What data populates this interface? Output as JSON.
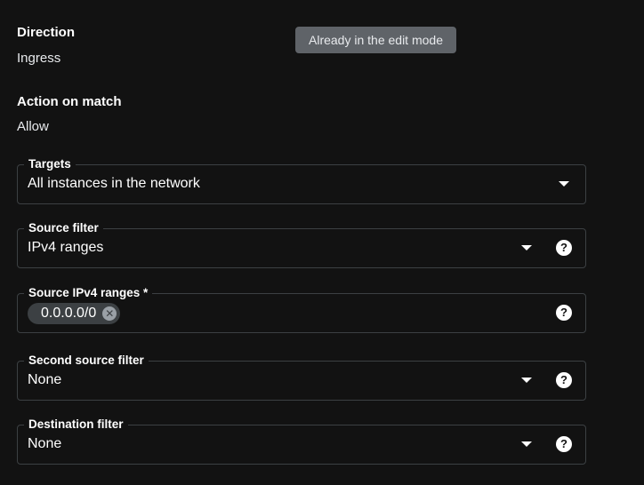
{
  "direction": {
    "label": "Direction",
    "value": "Ingress"
  },
  "action": {
    "label": "Action on match",
    "value": "Allow"
  },
  "tooltip": {
    "text": "Already in the edit mode"
  },
  "targets": {
    "label": "Targets",
    "value": "All instances in the network",
    "arrow_icon": "dropdown-arrow-icon"
  },
  "source_filter": {
    "label": "Source filter",
    "value": "IPv4 ranges",
    "arrow_icon": "dropdown-arrow-icon",
    "help_icon": "?"
  },
  "source_ipv4": {
    "label": "Source IPv4 ranges *",
    "chips": [
      "0.0.0.0/0"
    ],
    "chip_remove_icon": "✕",
    "help_icon": "?"
  },
  "second_source_filter": {
    "label": "Second source filter",
    "value": "None",
    "arrow_icon": "dropdown-arrow-icon",
    "help_icon": "?"
  },
  "destination_filter": {
    "label": "Destination filter",
    "value": "None",
    "arrow_icon": "dropdown-arrow-icon",
    "help_icon": "?"
  },
  "colors": {
    "background": "#121212",
    "border": "#3c4043",
    "tooltip_bg": "#5f6368",
    "chip_bg": "#3c4043",
    "text": "#ffffff"
  }
}
